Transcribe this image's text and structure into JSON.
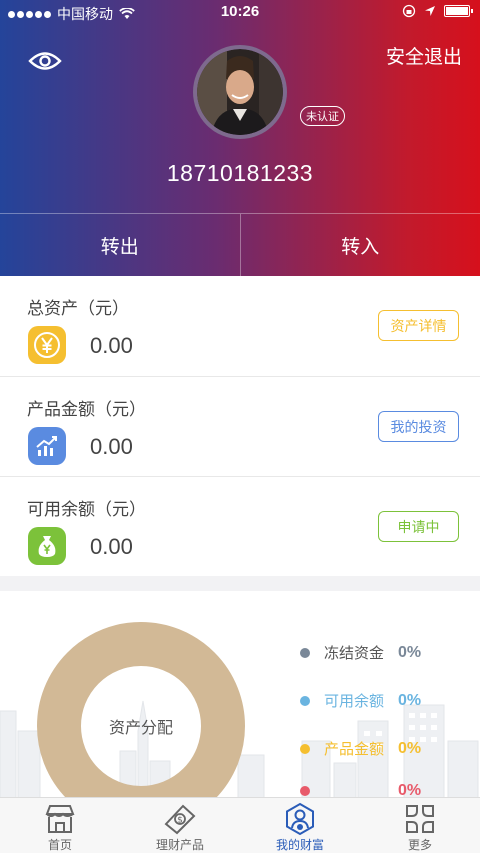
{
  "status_bar": {
    "carrier": "中国移动",
    "time": "10:26"
  },
  "header": {
    "logout": "安全退出",
    "verify_badge": "未认证",
    "phone": "18710181233",
    "actions": {
      "out": "转出",
      "in": "转入"
    }
  },
  "assets": [
    {
      "label": "总资产（元）",
      "value": "0.00",
      "button": "资产详情",
      "icon": "yuan-coin-icon",
      "color": "#f5bf30"
    },
    {
      "label": "产品金额（元）",
      "value": "0.00",
      "button": "我的投资",
      "icon": "trend-chart-icon",
      "color": "#5a8be0"
    },
    {
      "label": "可用余额（元）",
      "value": "0.00",
      "button": "申请中",
      "icon": "money-bag-icon",
      "color": "#7cc23a"
    }
  ],
  "allocation": {
    "center_label": "资产分配",
    "legend": [
      {
        "name": "冻结资金",
        "pct": "0%",
        "color": "#7a8898"
      },
      {
        "name": "可用余额",
        "pct": "0%",
        "color": "#6ab4e0"
      },
      {
        "name": "产品金额",
        "pct": "0%",
        "color": "#f5bf30"
      },
      {
        "name": "",
        "pct": "0%",
        "color": "#e85a6a"
      }
    ],
    "donut_color": "#d2b996"
  },
  "tabbar": [
    {
      "label": "首页",
      "icon": "store-icon"
    },
    {
      "label": "理财产品",
      "icon": "money-bill-icon"
    },
    {
      "label": "我的财富",
      "icon": "user-wealth-icon",
      "active": true
    },
    {
      "label": "更多",
      "icon": "grid-more-icon"
    }
  ]
}
